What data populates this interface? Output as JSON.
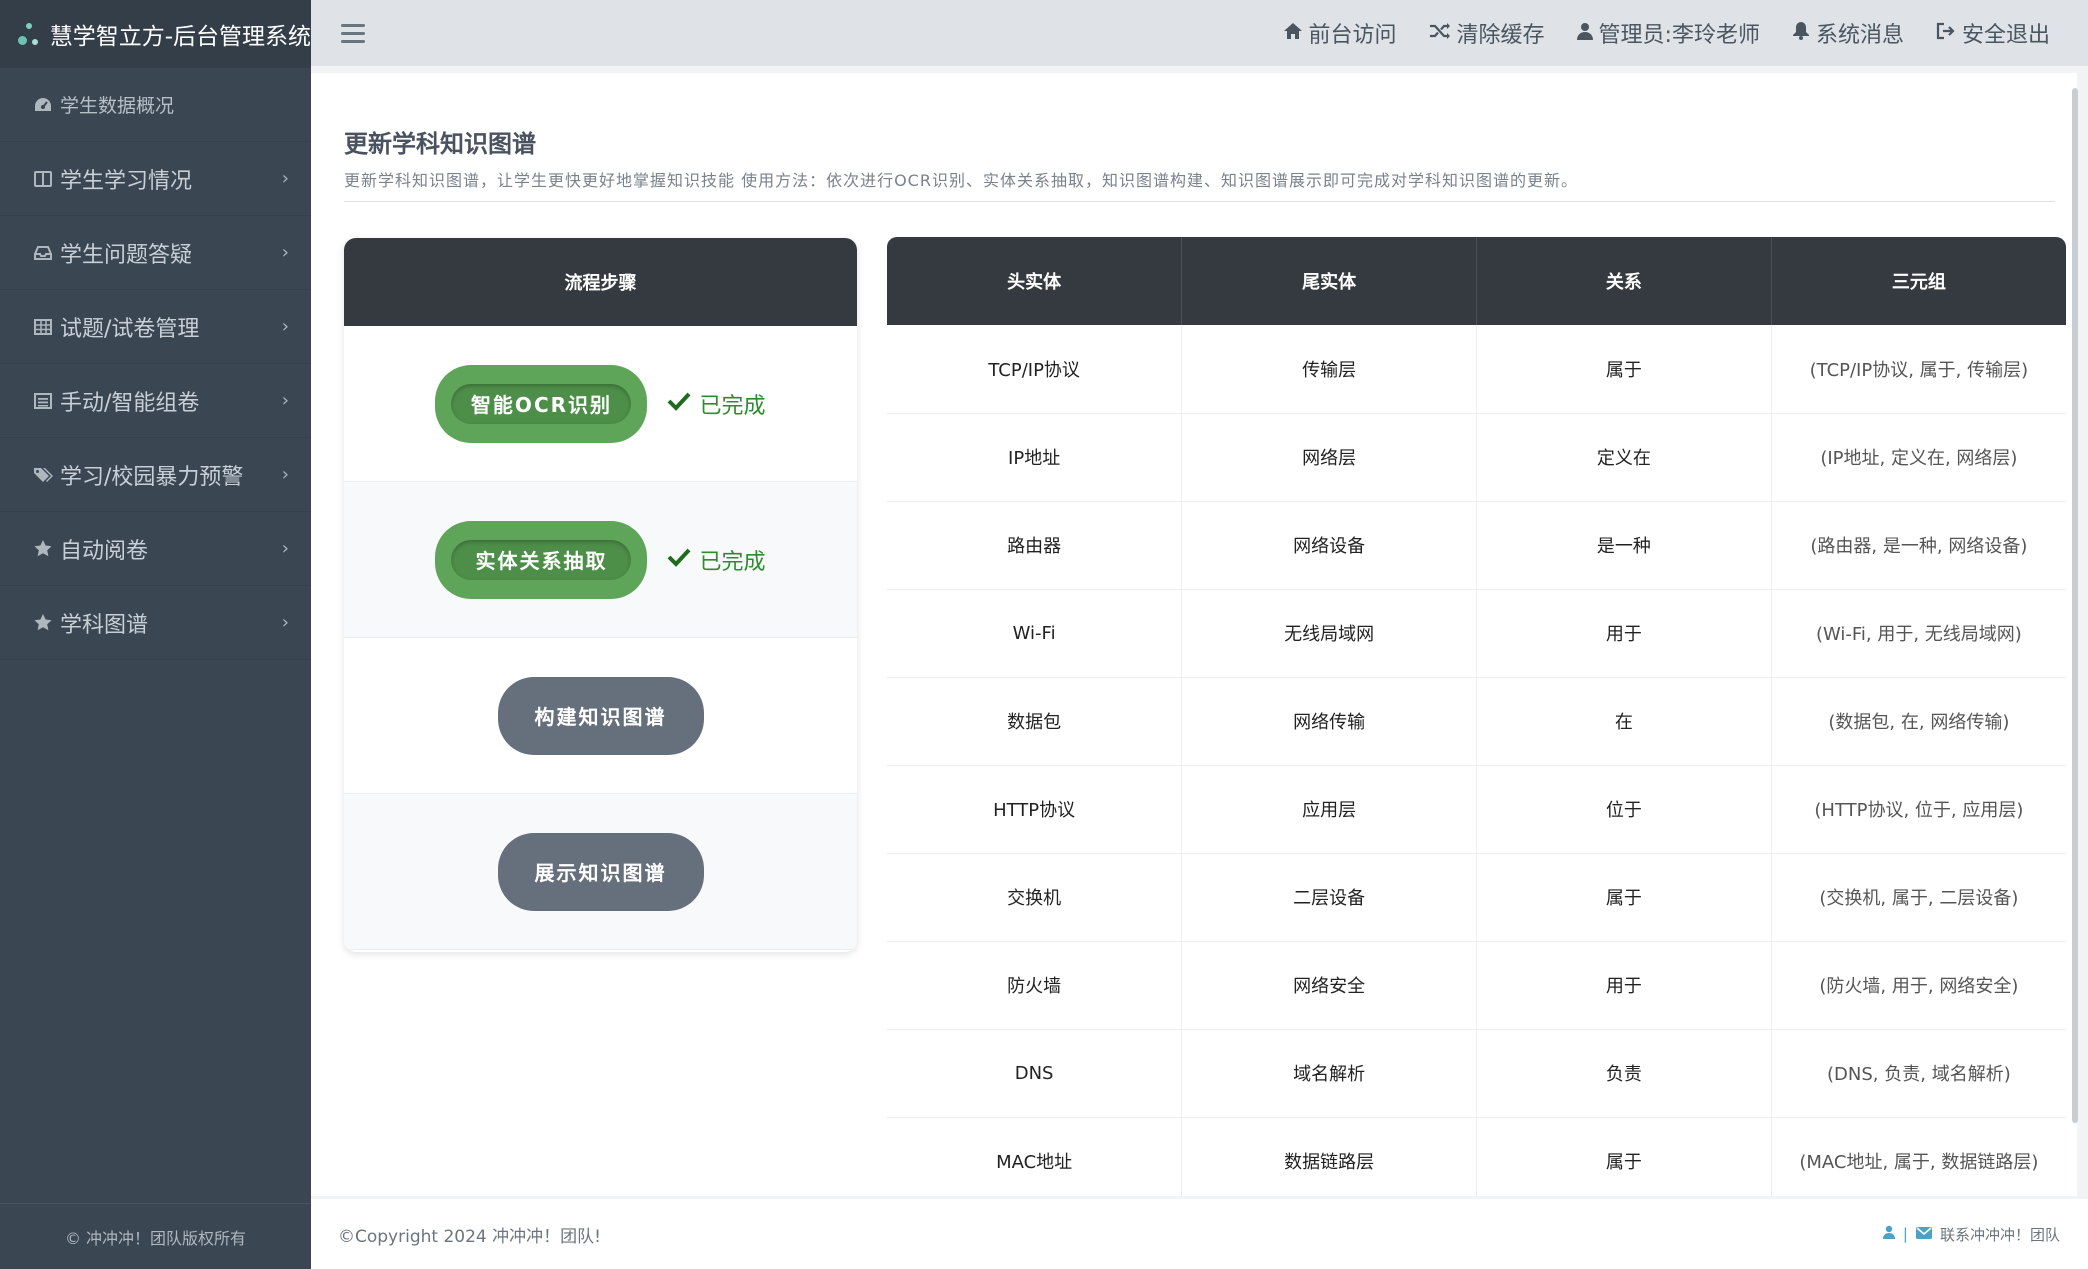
{
  "brand": {
    "title": "慧学智立方-后台管理系统"
  },
  "sidebar": {
    "items": [
      {
        "label": "学生数据概况",
        "icon": "dashboard-icon",
        "has_chevron": false
      },
      {
        "label": "学生学习情况",
        "icon": "book-icon",
        "has_chevron": true
      },
      {
        "label": "学生问题答疑",
        "icon": "inbox-icon",
        "has_chevron": true
      },
      {
        "label": "试题/试卷管理",
        "icon": "table-icon",
        "has_chevron": true
      },
      {
        "label": "手动/智能组卷",
        "icon": "list-alt-icon",
        "has_chevron": true
      },
      {
        "label": "学习/校园暴力预警",
        "icon": "tags-icon",
        "has_chevron": true
      },
      {
        "label": "自动阅卷",
        "icon": "star-icon",
        "has_chevron": true
      },
      {
        "label": "学科图谱",
        "icon": "star-icon",
        "has_chevron": true
      }
    ],
    "footer": "© 冲冲冲！团队版权所有"
  },
  "topbar": {
    "links": [
      {
        "label": "前台访问",
        "icon": "home-icon"
      },
      {
        "label": "清除缓存",
        "icon": "random-icon"
      },
      {
        "label": "管理员:李玲老师",
        "icon": "user-icon"
      },
      {
        "label": "系统消息",
        "icon": "bell-icon"
      },
      {
        "label": "安全退出",
        "icon": "sign-out-icon"
      }
    ]
  },
  "page": {
    "title": "更新学科知识图谱",
    "description": "更新学科知识图谱，让学生更快更好地掌握知识技能 使用方法：依次进行OCR识别、实体关系抽取，知识图谱构建、知识图谱展示即可完成对学科知识图谱的更新。"
  },
  "steps": {
    "header": "流程步骤",
    "items": [
      {
        "label": "智能OCR识别",
        "status": "已完成",
        "style": "green"
      },
      {
        "label": "实体关系抽取",
        "status": "已完成",
        "style": "green"
      },
      {
        "label": "构建知识图谱",
        "status": "",
        "style": "gray"
      },
      {
        "label": "展示知识图谱",
        "status": "",
        "style": "gray"
      }
    ]
  },
  "table": {
    "headers": [
      "头实体",
      "尾实体",
      "关系",
      "三元组"
    ],
    "rows": [
      [
        "TCP/IP协议",
        "传输层",
        "属于",
        "(TCP/IP协议, 属于, 传输层)"
      ],
      [
        "IP地址",
        "网络层",
        "定义在",
        "(IP地址, 定义在, 网络层)"
      ],
      [
        "路由器",
        "网络设备",
        "是一种",
        "(路由器, 是一种, 网络设备)"
      ],
      [
        "Wi-Fi",
        "无线局域网",
        "用于",
        "(Wi-Fi, 用于, 无线局域网)"
      ],
      [
        "数据包",
        "网络传输",
        "在",
        "(数据包, 在, 网络传输)"
      ],
      [
        "HTTP协议",
        "应用层",
        "位于",
        "(HTTP协议, 位于, 应用层)"
      ],
      [
        "交换机",
        "二层设备",
        "属于",
        "(交换机, 属于, 二层设备)"
      ],
      [
        "防火墙",
        "网络安全",
        "用于",
        "(防火墙, 用于, 网络安全)"
      ],
      [
        "DNS",
        "域名解析",
        "负责",
        "(DNS, 负责, 域名解析)"
      ],
      [
        "MAC地址",
        "数据链路层",
        "属于",
        "(MAC地址, 属于, 数据链路层)"
      ]
    ]
  },
  "footer": {
    "copyright": "©Copyright 2024 冲冲冲！团队!",
    "contact_sep": "|",
    "contact": "联系冲冲冲！团队"
  },
  "colors": {
    "sidebar_bg": "#3a4652",
    "header_dark": "#343a40",
    "success_green": "#5ea559",
    "pending_gray": "#666f7c"
  }
}
